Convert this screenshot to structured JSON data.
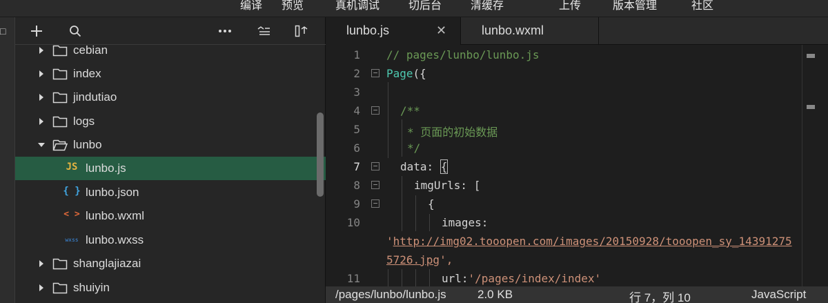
{
  "menubar": {
    "items": [
      "编译",
      "预览",
      "真机调试",
      "切后台",
      "清缓存",
      "上传",
      "版本管理",
      "社区"
    ]
  },
  "explorer": {
    "toolbar_icons": [
      "add-icon",
      "search-icon",
      "more-icon",
      "collapse-tree-icon",
      "split-pane-icon"
    ],
    "tree": [
      {
        "type": "folder",
        "name": "cebian",
        "expanded": false
      },
      {
        "type": "folder",
        "name": "index",
        "expanded": false
      },
      {
        "type": "folder",
        "name": "jindutiao",
        "expanded": false
      },
      {
        "type": "folder",
        "name": "logs",
        "expanded": false
      },
      {
        "type": "folder",
        "name": "lunbo",
        "expanded": true
      },
      {
        "type": "file",
        "name": "lunbo.js",
        "icon": "JS",
        "selected": true
      },
      {
        "type": "file",
        "name": "lunbo.json",
        "icon": "{ }"
      },
      {
        "type": "file",
        "name": "lunbo.wxml",
        "icon": "< >"
      },
      {
        "type": "file",
        "name": "lunbo.wxss",
        "icon": "wxss"
      },
      {
        "type": "folder",
        "name": "shanglajiazai",
        "expanded": false
      },
      {
        "type": "folder",
        "name": "shuiyin",
        "expanded": false
      }
    ]
  },
  "editor": {
    "tabs": [
      {
        "label": "lunbo.js",
        "active": true
      },
      {
        "label": "lunbo.wxml",
        "active": false
      }
    ],
    "line_numbers": [
      "1",
      "2",
      "3",
      "4",
      "5",
      "6",
      "7",
      "8",
      "9",
      "10",
      "11"
    ],
    "code": {
      "l1": "// pages/lunbo/lunbo.js",
      "l2_kw": "Page",
      "l2_rest": "({",
      "l4": "/**",
      "l5": "* 页面的初始数据",
      "l6": "*/",
      "l7_a": "data: ",
      "l7_b": "{",
      "l8": "imgUrls: [",
      "l9": "{",
      "l10": "images:",
      "l10b_q": "'",
      "l10b_url": "http://img02.tooopen.com/images/20150928/tooopen_sy_14391275",
      "l10c_url": "5726.jpg",
      "l10c_end": "',",
      "l11_a": "url:",
      "l11_b": "'/pages/index/index'"
    }
  },
  "statusbar": {
    "path": "/pages/lunbo/lunbo.js",
    "size": "2.0 KB",
    "position": "行 7，列 10",
    "language": "JavaScript"
  },
  "colors": {
    "selected_row": "#265c43",
    "comment": "#6a9955",
    "string": "#ce9178",
    "keyword": "#4ec9b0"
  }
}
